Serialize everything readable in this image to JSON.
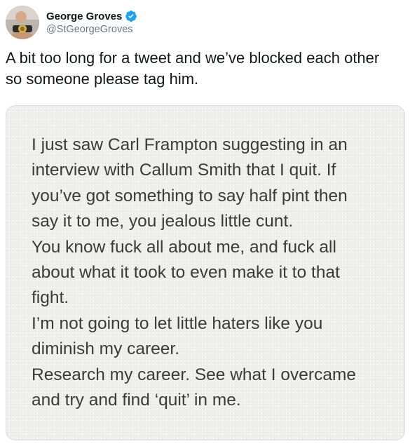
{
  "author": {
    "display_name": "George Groves",
    "handle": "@StGeorgeGroves",
    "verified": true,
    "avatar_icon": "profile-photo-with-championship-belt",
    "verified_icon": "verified-badge-icon",
    "verified_color": "#1da1f2"
  },
  "tweet": {
    "text_lines": [
      "A bit too long for a tweet and we’ve blocked each other",
      "so someone please tag him."
    ]
  },
  "media": {
    "note_lines": [
      "I just saw Carl Frampton suggesting in an",
      "interview with Callum Smith that I quit. If",
      "you’ve got something to say half pint then",
      "say it to me, you jealous little cunt.",
      "You know fuck all about me, and fuck all",
      "about what it took to even make it to that",
      "fight.",
      "I’m not going to let little haters like you",
      "diminish my career.",
      "Research my career. See what I overcame",
      "and try and find ‘quit’ in me."
    ]
  }
}
